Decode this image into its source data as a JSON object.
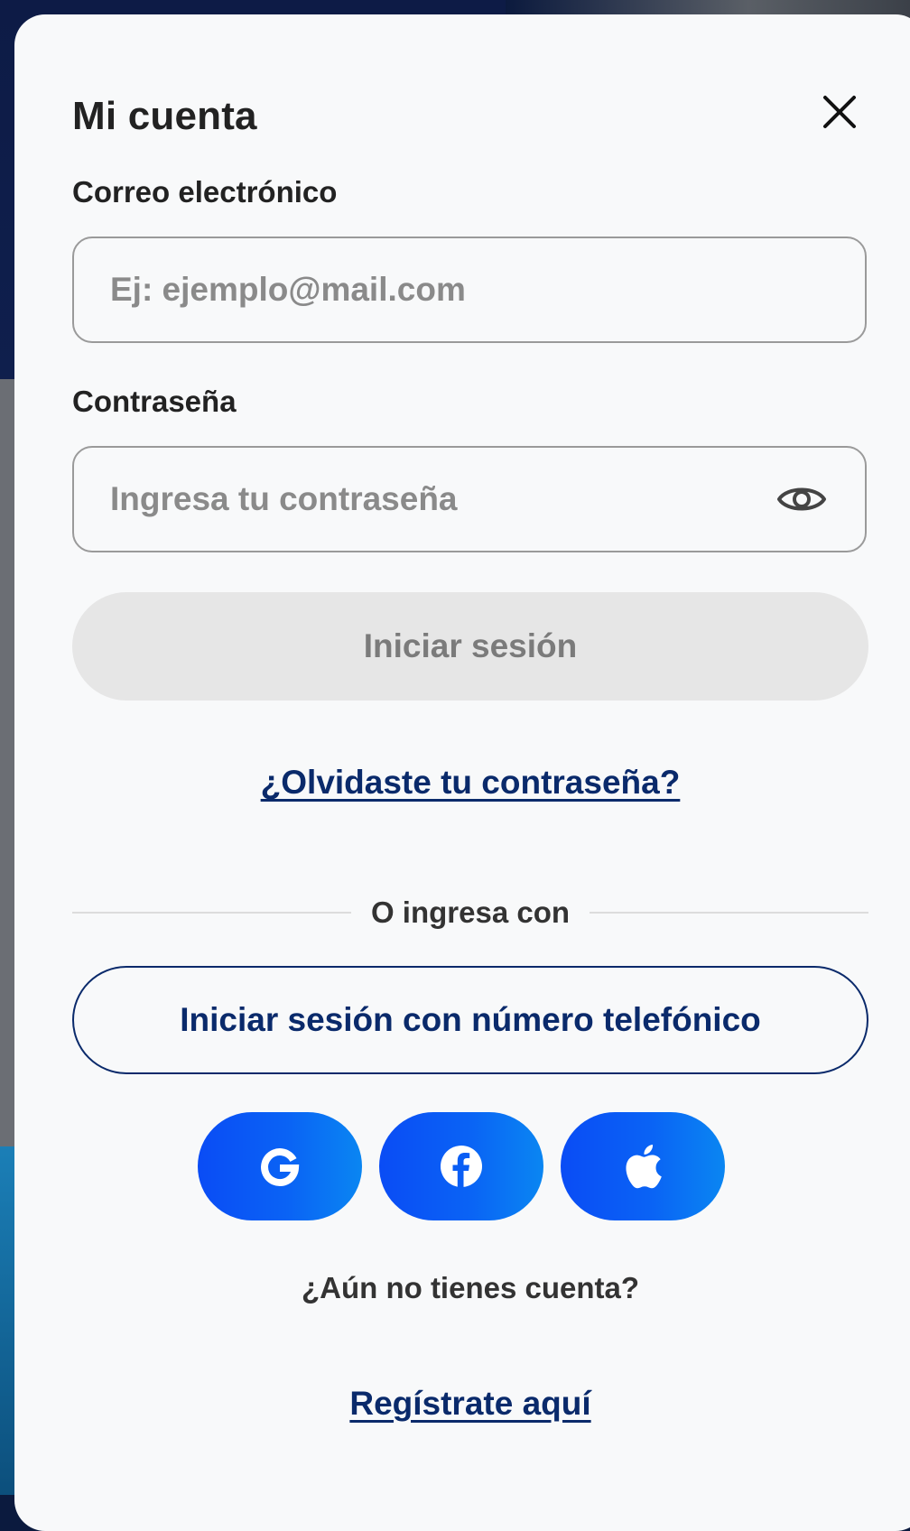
{
  "modal": {
    "title": "Mi cuenta"
  },
  "email": {
    "label": "Correo electrónico",
    "placeholder": "Ej: ejemplo@mail.com",
    "value": ""
  },
  "password": {
    "label": "Contraseña",
    "placeholder": "Ingresa tu contraseña",
    "value": ""
  },
  "actions": {
    "login_label": "Iniciar sesión",
    "forgot_label": "¿Olvidaste tu contraseña?",
    "divider_label": "O ingresa con",
    "phone_login_label": "Iniciar sesión con número telefónico",
    "no_account_text": "¿Aún no tienes cuenta?",
    "register_label": "Regístrate aquí"
  },
  "social": [
    {
      "icon": "google-icon"
    },
    {
      "icon": "facebook-icon"
    },
    {
      "icon": "apple-icon"
    }
  ],
  "colors": {
    "link": "#0a2a6b",
    "social_gradient_start": "#0a4cf5",
    "social_gradient_end": "#0a86f2",
    "disabled_button": "#e6e6e6"
  }
}
